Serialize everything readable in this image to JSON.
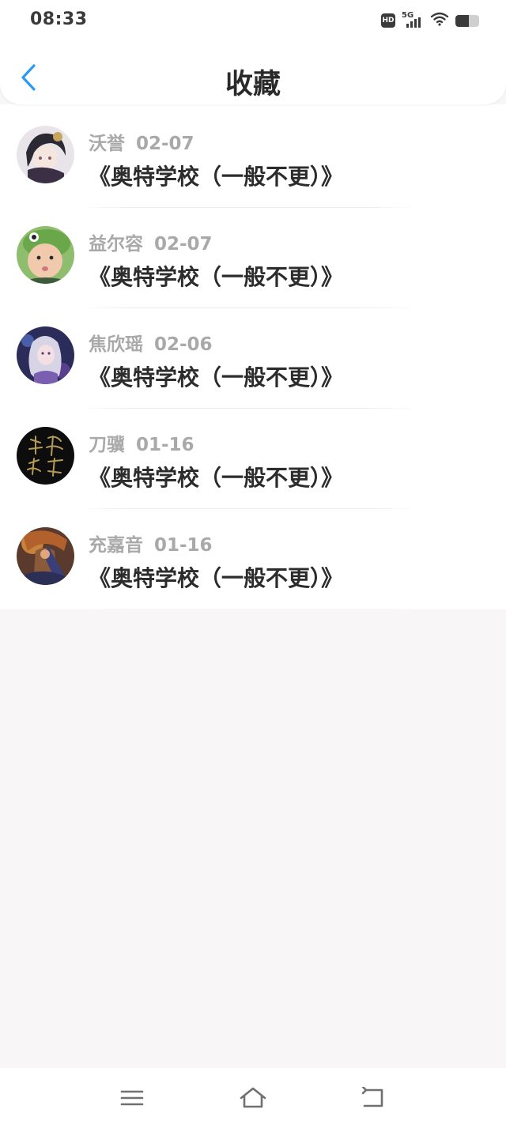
{
  "status_bar": {
    "time": "08:33",
    "hd_label": "HD",
    "network_label": "5G",
    "battery_level": 0.55,
    "icons": [
      "hd-icon",
      "signal-5g-icon",
      "wifi-icon",
      "battery-icon"
    ]
  },
  "header": {
    "title": "收藏",
    "back_icon": "chevron-left-icon",
    "accent_color": "#2b9af3"
  },
  "favorites": [
    {
      "author": "沃誉",
      "date": "02-07",
      "book_title": "《奥特学校（一般不更）》",
      "avatar": "avatar-anime-boy"
    },
    {
      "author": "益尔容",
      "date": "02-07",
      "book_title": "《奥特学校（一般不更）》",
      "avatar": "avatar-child-photo"
    },
    {
      "author": "焦欣瑶",
      "date": "02-06",
      "book_title": "《奥特学校（一般不更）》",
      "avatar": "avatar-anime-girl"
    },
    {
      "author": "刀骥",
      "date": "01-16",
      "book_title": "《奥特学校（一般不更）》",
      "avatar": "avatar-calligraphy-dark"
    },
    {
      "author": "充嘉音",
      "date": "01-16",
      "book_title": "《奥特学校（一般不更）》",
      "avatar": "avatar-warrior-art"
    }
  ],
  "bottom_nav": {
    "items": [
      "menu-icon",
      "home-icon",
      "back-icon"
    ]
  },
  "colors": {
    "background": "#f8f6f7",
    "card": "#ffffff",
    "meta_text": "#a9a9a9",
    "title_text": "#2c2c2c"
  }
}
